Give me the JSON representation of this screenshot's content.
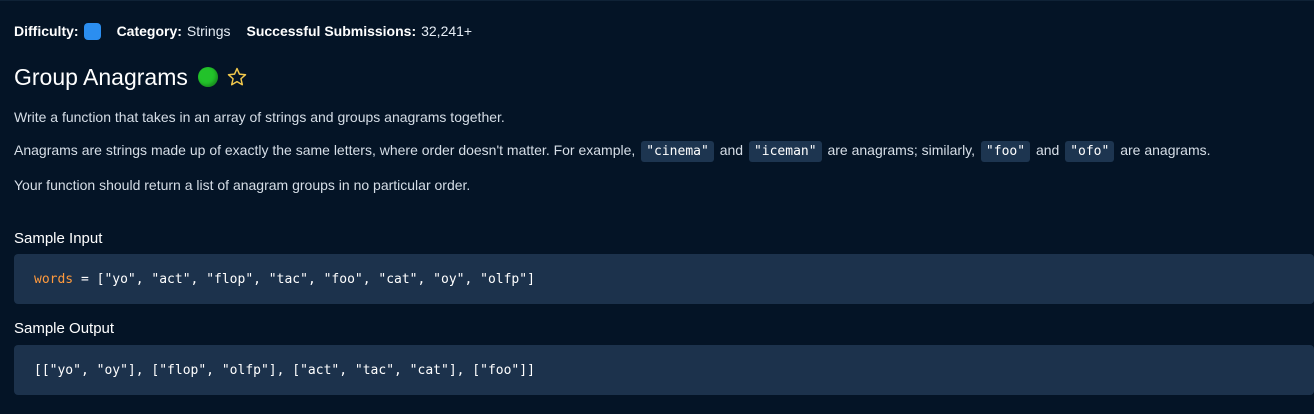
{
  "header": {
    "difficulty_label": "Difficulty:",
    "difficulty_color": "#2b8ef0",
    "category_label": "Category:",
    "category_value": "Strings",
    "submissions_label": "Successful Submissions:",
    "submissions_value": "32,241+"
  },
  "problem": {
    "title": "Group Anagrams",
    "status_color": "#22c22a",
    "star_color": "#f2c94c",
    "star_icon": "star-outline-icon",
    "status_icon": "completed-dot-icon"
  },
  "description": {
    "p1": "Write a function that takes in an array of strings and groups anagrams together.",
    "p2": {
      "t1": "Anagrams are strings made up of exactly the same letters, where order doesn't matter. For example,",
      "c1": "\"cinema\"",
      "t2": "and",
      "c2": "\"iceman\"",
      "t3": "are anagrams; similarly,",
      "c3": "\"foo\"",
      "t4": "and",
      "c4": "\"ofo\"",
      "t5": "are anagrams."
    },
    "p3": "Your function should return a list of anagram groups in no particular order."
  },
  "sample_input": {
    "title": "Sample Input",
    "var_name": "words",
    "rest": " = [\"yo\", \"act\", \"flop\", \"tac\", \"foo\", \"cat\", \"oy\", \"olfp\"]"
  },
  "sample_output": {
    "title": "Sample Output",
    "code": "[[\"yo\", \"oy\"], [\"flop\", \"olfp\"], [\"act\", \"tac\", \"cat\"], [\"foo\"]]"
  }
}
